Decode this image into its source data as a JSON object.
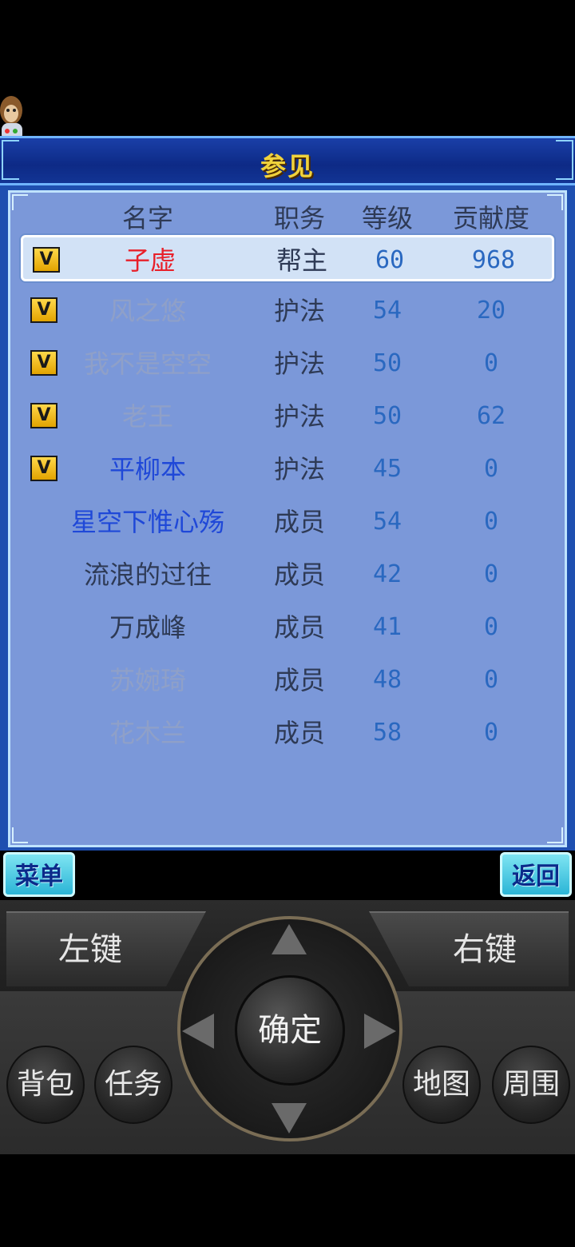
{
  "title": "参见",
  "headers": {
    "name": "名字",
    "role": "职务",
    "level": "等级",
    "contribution": "贡献度"
  },
  "members": [
    {
      "vip": true,
      "name": "子虚",
      "name_color": "#e8202a",
      "role": "帮主",
      "level": "60",
      "contribution": "968",
      "selected": true
    },
    {
      "vip": true,
      "name": "风之悠",
      "name_color": "#8fa0c8",
      "role": "护法",
      "level": "54",
      "contribution": "20"
    },
    {
      "vip": true,
      "name": "我不是空空",
      "name_color": "#8fa0c8",
      "role": "护法",
      "level": "50",
      "contribution": "0"
    },
    {
      "vip": true,
      "name": "老王",
      "name_color": "#8fa0c8",
      "role": "护法",
      "level": "50",
      "contribution": "62"
    },
    {
      "vip": true,
      "name": "平柳本",
      "name_color": "#1f48d8",
      "role": "护法",
      "level": "45",
      "contribution": "0"
    },
    {
      "vip": false,
      "name": "星空下惟心殇",
      "name_color": "#1f48d8",
      "role": "成员",
      "level": "54",
      "contribution": "0"
    },
    {
      "vip": false,
      "name": "流浪的过往",
      "name_color": "#2e3a55",
      "role": "成员",
      "level": "42",
      "contribution": "0"
    },
    {
      "vip": false,
      "name": "万成峰",
      "name_color": "#2e3a55",
      "role": "成员",
      "level": "41",
      "contribution": "0"
    },
    {
      "vip": false,
      "name": "苏婉琦",
      "name_color": "#8fa0c8",
      "role": "成员",
      "level": "48",
      "contribution": "0"
    },
    {
      "vip": false,
      "name": "花木兰",
      "name_color": "#8fa0c8",
      "role": "成员",
      "level": "58",
      "contribution": "0"
    }
  ],
  "softkeys": {
    "left": "菜单",
    "right": "返回"
  },
  "controller": {
    "left_key": "左键",
    "right_key": "右键",
    "ok": "确定",
    "buttons": [
      "背包",
      "任务",
      "地图",
      "周围"
    ]
  }
}
